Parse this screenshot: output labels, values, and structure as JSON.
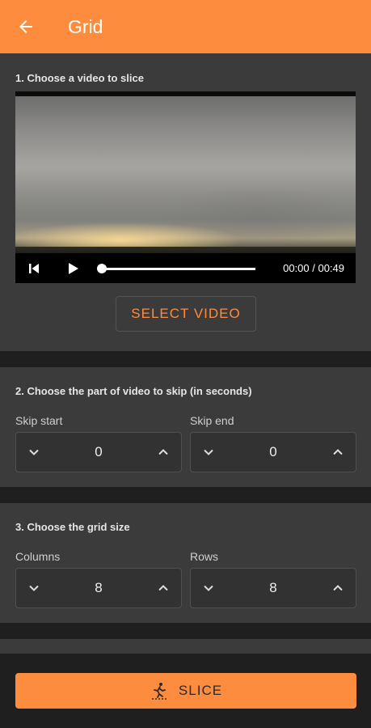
{
  "appbar": {
    "title": "Grid",
    "back_icon": "arrow-left-icon"
  },
  "colors": {
    "accent": "#fd8c3e",
    "card": "#3b3b3b",
    "background": "#1f1f1f"
  },
  "step1": {
    "title": "1. Choose a video to slice",
    "player": {
      "time": "00:00 / 00:49",
      "progress": 0
    },
    "select_label": "SELECT VIDEO"
  },
  "step2": {
    "title": "2. Choose the part of video to skip (in seconds)",
    "skip_start": {
      "label": "Skip start",
      "value": "0"
    },
    "skip_end": {
      "label": "Skip end",
      "value": "0"
    }
  },
  "step3": {
    "title": "3. Choose the grid size",
    "columns": {
      "label": "Columns",
      "value": "8"
    },
    "rows": {
      "label": "Rows",
      "value": "8"
    }
  },
  "slice": {
    "label": "SLICE",
    "icon": "slice-figure-icon"
  }
}
